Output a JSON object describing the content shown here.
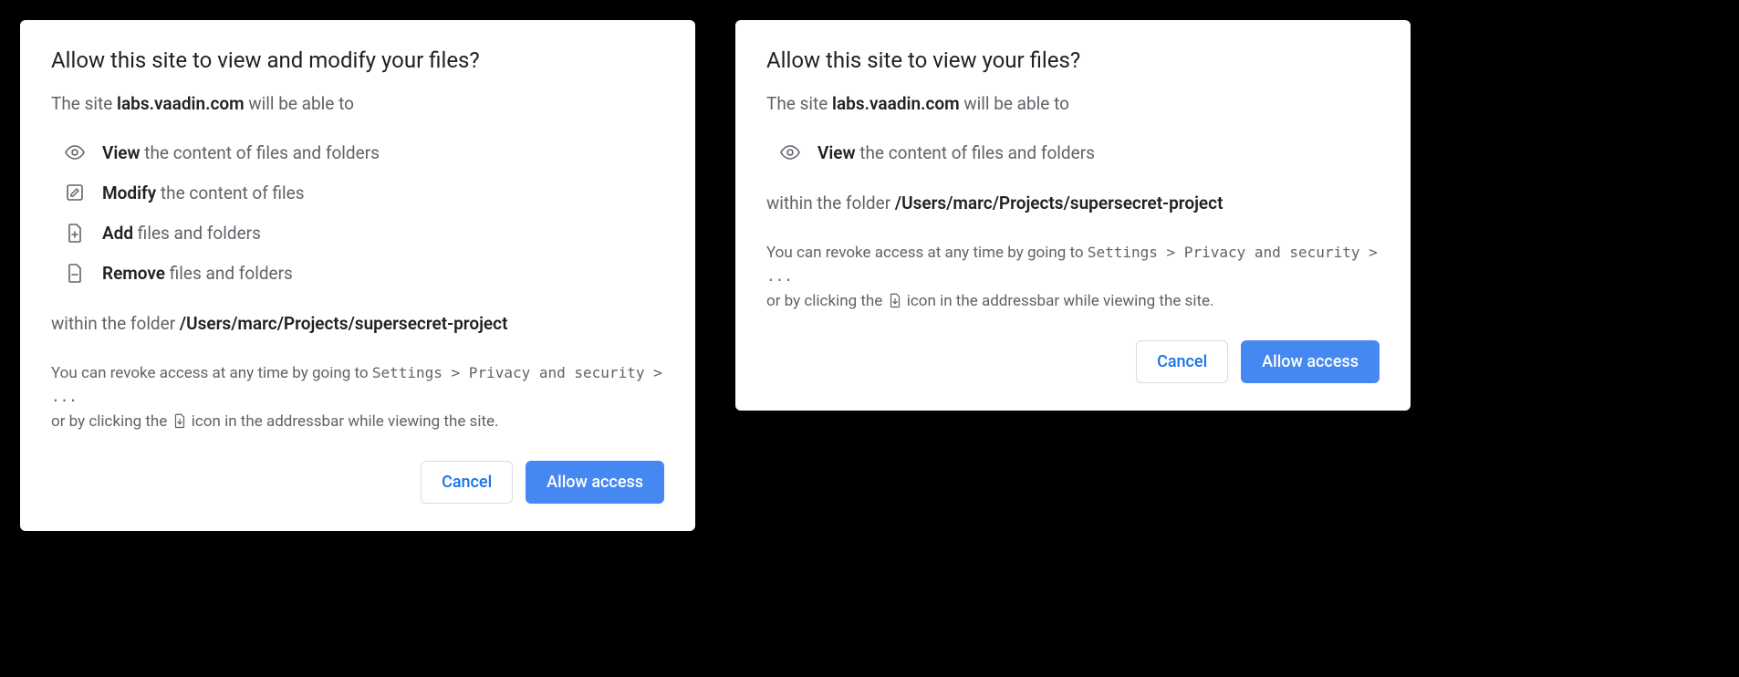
{
  "left": {
    "title": "Allow this site to view and modify your files?",
    "subtitle_prefix": "The site ",
    "domain": "labs.vaadin.com",
    "subtitle_suffix": " will be able to",
    "permissions": [
      {
        "verb": "View",
        "rest": " the content of files and folders"
      },
      {
        "verb": "Modify",
        "rest": " the content of files"
      },
      {
        "verb": "Add",
        "rest": " files and folders"
      },
      {
        "verb": "Remove",
        "rest": " files and folders"
      }
    ],
    "folder_prefix": "within the folder ",
    "folder_path": "/Users/marc/Projects/supersecret-project",
    "revoke_prefix": "You can revoke access at any time by going to ",
    "revoke_path": "Settings > Privacy and security > ...",
    "revoke_line2_a": "or by clicking the ",
    "revoke_line2_b": " icon in the addressbar while viewing the site.",
    "cancel": "Cancel",
    "allow": "Allow access"
  },
  "right": {
    "title": "Allow this site to view your files?",
    "subtitle_prefix": "The site ",
    "domain": "labs.vaadin.com",
    "subtitle_suffix": " will be able to",
    "permissions": [
      {
        "verb": "View",
        "rest": " the content of files and folders"
      }
    ],
    "folder_prefix": "within the folder ",
    "folder_path": "/Users/marc/Projects/supersecret-project",
    "revoke_prefix": "You can revoke access at any time by going to ",
    "revoke_path": "Settings > Privacy and security > ...",
    "revoke_line2_a": "or by clicking the ",
    "revoke_line2_b": " icon in the addressbar while viewing the site.",
    "cancel": "Cancel",
    "allow": "Allow access"
  }
}
